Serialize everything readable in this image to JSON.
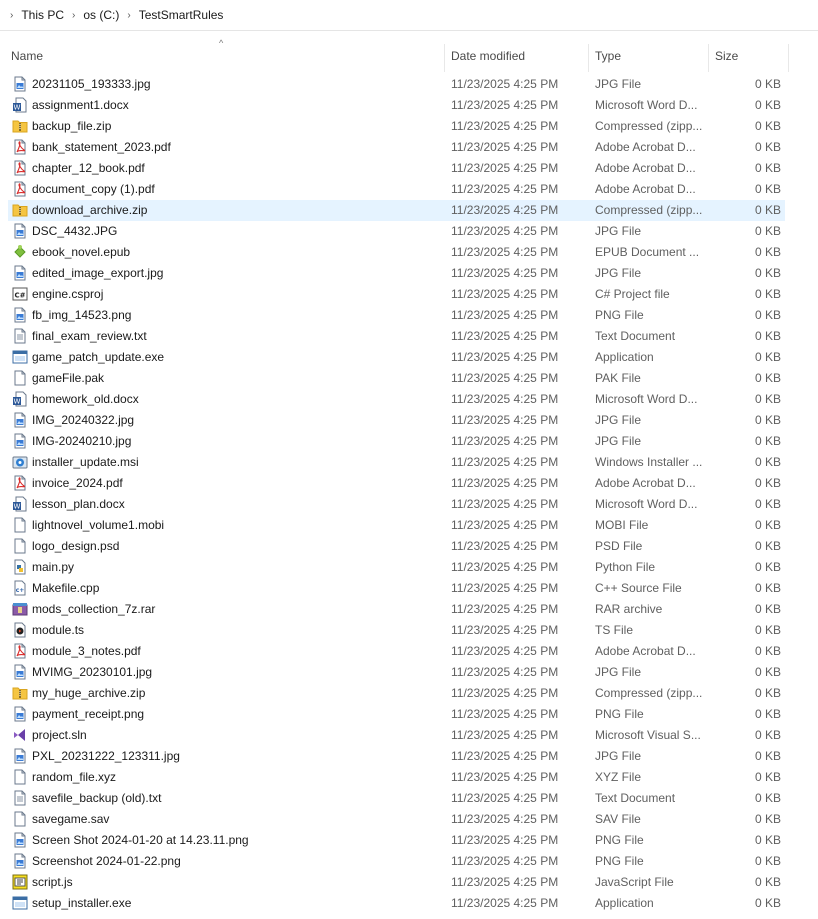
{
  "breadcrumb": {
    "items": [
      "This PC",
      "os (C:)",
      "TestSmartRules"
    ]
  },
  "columns": {
    "name": "Name",
    "date": "Date modified",
    "type": "Type",
    "size": "Size"
  },
  "selected_index": 6,
  "files": [
    {
      "name": "20231105_193333.jpg",
      "date": "11/23/2025 4:25 PM",
      "type": "JPG File",
      "size": "0 KB",
      "icon": "image-file-icon"
    },
    {
      "name": "assignment1.docx",
      "date": "11/23/2025 4:25 PM",
      "type": "Microsoft Word D...",
      "size": "0 KB",
      "icon": "word-document-icon"
    },
    {
      "name": "backup_file.zip",
      "date": "11/23/2025 4:25 PM",
      "type": "Compressed (zipp...",
      "size": "0 KB",
      "icon": "zip-folder-icon"
    },
    {
      "name": "bank_statement_2023.pdf",
      "date": "11/23/2025 4:25 PM",
      "type": "Adobe Acrobat D...",
      "size": "0 KB",
      "icon": "pdf-file-icon"
    },
    {
      "name": "chapter_12_book.pdf",
      "date": "11/23/2025 4:25 PM",
      "type": "Adobe Acrobat D...",
      "size": "0 KB",
      "icon": "pdf-file-icon"
    },
    {
      "name": "document_copy (1).pdf",
      "date": "11/23/2025 4:25 PM",
      "type": "Adobe Acrobat D...",
      "size": "0 KB",
      "icon": "pdf-file-icon"
    },
    {
      "name": "download_archive.zip",
      "date": "11/23/2025 4:25 PM",
      "type": "Compressed (zipp...",
      "size": "0 KB",
      "icon": "zip-folder-icon"
    },
    {
      "name": "DSC_4432.JPG",
      "date": "11/23/2025 4:25 PM",
      "type": "JPG File",
      "size": "0 KB",
      "icon": "image-file-icon"
    },
    {
      "name": "ebook_novel.epub",
      "date": "11/23/2025 4:25 PM",
      "type": "EPUB Document ...",
      "size": "0 KB",
      "icon": "epub-file-icon"
    },
    {
      "name": "edited_image_export.jpg",
      "date": "11/23/2025 4:25 PM",
      "type": "JPG File",
      "size": "0 KB",
      "icon": "image-file-icon"
    },
    {
      "name": "engine.csproj",
      "date": "11/23/2025 4:25 PM",
      "type": "C# Project file",
      "size": "0 KB",
      "icon": "csharp-project-icon"
    },
    {
      "name": "fb_img_14523.png",
      "date": "11/23/2025 4:25 PM",
      "type": "PNG File",
      "size": "0 KB",
      "icon": "image-file-icon"
    },
    {
      "name": "final_exam_review.txt",
      "date": "11/23/2025 4:25 PM",
      "type": "Text Document",
      "size": "0 KB",
      "icon": "text-file-icon"
    },
    {
      "name": "game_patch_update.exe",
      "date": "11/23/2025 4:25 PM",
      "type": "Application",
      "size": "0 KB",
      "icon": "application-icon"
    },
    {
      "name": "gameFile.pak",
      "date": "11/23/2025 4:25 PM",
      "type": "PAK File",
      "size": "0 KB",
      "icon": "blank-file-icon"
    },
    {
      "name": "homework_old.docx",
      "date": "11/23/2025 4:25 PM",
      "type": "Microsoft Word D...",
      "size": "0 KB",
      "icon": "word-document-icon"
    },
    {
      "name": "IMG_20240322.jpg",
      "date": "11/23/2025 4:25 PM",
      "type": "JPG File",
      "size": "0 KB",
      "icon": "image-file-icon"
    },
    {
      "name": "IMG-20240210.jpg",
      "date": "11/23/2025 4:25 PM",
      "type": "JPG File",
      "size": "0 KB",
      "icon": "image-file-icon"
    },
    {
      "name": "installer_update.msi",
      "date": "11/23/2025 4:25 PM",
      "type": "Windows Installer ...",
      "size": "0 KB",
      "icon": "installer-icon"
    },
    {
      "name": "invoice_2024.pdf",
      "date": "11/23/2025 4:25 PM",
      "type": "Adobe Acrobat D...",
      "size": "0 KB",
      "icon": "pdf-file-icon"
    },
    {
      "name": "lesson_plan.docx",
      "date": "11/23/2025 4:25 PM",
      "type": "Microsoft Word D...",
      "size": "0 KB",
      "icon": "word-document-icon"
    },
    {
      "name": "lightnovel_volume1.mobi",
      "date": "11/23/2025 4:25 PM",
      "type": "MOBI File",
      "size": "0 KB",
      "icon": "blank-file-icon"
    },
    {
      "name": "logo_design.psd",
      "date": "11/23/2025 4:25 PM",
      "type": "PSD File",
      "size": "0 KB",
      "icon": "blank-file-icon"
    },
    {
      "name": "main.py",
      "date": "11/23/2025 4:25 PM",
      "type": "Python File",
      "size": "0 KB",
      "icon": "python-file-icon"
    },
    {
      "name": "Makefile.cpp",
      "date": "11/23/2025 4:25 PM",
      "type": "C++ Source File",
      "size": "0 KB",
      "icon": "cpp-file-icon"
    },
    {
      "name": "mods_collection_7z.rar",
      "date": "11/23/2025 4:25 PM",
      "type": "RAR archive",
      "size": "0 KB",
      "icon": "rar-archive-icon"
    },
    {
      "name": "module.ts",
      "date": "11/23/2025 4:25 PM",
      "type": "TS File",
      "size": "0 KB",
      "icon": "media-file-icon"
    },
    {
      "name": "module_3_notes.pdf",
      "date": "11/23/2025 4:25 PM",
      "type": "Adobe Acrobat D...",
      "size": "0 KB",
      "icon": "pdf-file-icon"
    },
    {
      "name": "MVIMG_20230101.jpg",
      "date": "11/23/2025 4:25 PM",
      "type": "JPG File",
      "size": "0 KB",
      "icon": "image-file-icon"
    },
    {
      "name": "my_huge_archive.zip",
      "date": "11/23/2025 4:25 PM",
      "type": "Compressed (zipp...",
      "size": "0 KB",
      "icon": "zip-folder-icon"
    },
    {
      "name": "payment_receipt.png",
      "date": "11/23/2025 4:25 PM",
      "type": "PNG File",
      "size": "0 KB",
      "icon": "image-file-icon"
    },
    {
      "name": "project.sln",
      "date": "11/23/2025 4:25 PM",
      "type": "Microsoft Visual S...",
      "size": "0 KB",
      "icon": "visual-studio-icon"
    },
    {
      "name": "PXL_20231222_123311.jpg",
      "date": "11/23/2025 4:25 PM",
      "type": "JPG File",
      "size": "0 KB",
      "icon": "image-file-icon"
    },
    {
      "name": "random_file.xyz",
      "date": "11/23/2025 4:25 PM",
      "type": "XYZ File",
      "size": "0 KB",
      "icon": "blank-file-icon"
    },
    {
      "name": "savefile_backup (old).txt",
      "date": "11/23/2025 4:25 PM",
      "type": "Text Document",
      "size": "0 KB",
      "icon": "text-file-icon"
    },
    {
      "name": "savegame.sav",
      "date": "11/23/2025 4:25 PM",
      "type": "SAV File",
      "size": "0 KB",
      "icon": "blank-file-icon"
    },
    {
      "name": "Screen Shot 2024-01-20 at 14.23.11.png",
      "date": "11/23/2025 4:25 PM",
      "type": "PNG File",
      "size": "0 KB",
      "icon": "image-file-icon"
    },
    {
      "name": "Screenshot 2024-01-22.png",
      "date": "11/23/2025 4:25 PM",
      "type": "PNG File",
      "size": "0 KB",
      "icon": "image-file-icon"
    },
    {
      "name": "script.js",
      "date": "11/23/2025 4:25 PM",
      "type": "JavaScript File",
      "size": "0 KB",
      "icon": "javascript-file-icon"
    },
    {
      "name": "setup_installer.exe",
      "date": "11/23/2025 4:25 PM",
      "type": "Application",
      "size": "0 KB",
      "icon": "application-icon"
    }
  ]
}
